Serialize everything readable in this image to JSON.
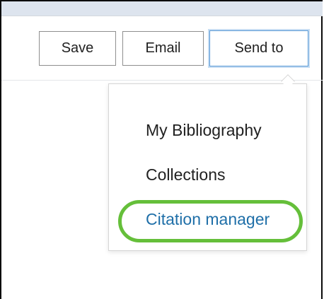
{
  "toolbar": {
    "save_label": "Save",
    "email_label": "Email",
    "send_to_label": "Send to"
  },
  "send_to_menu": {
    "items": [
      {
        "label": "My Bibliography"
      },
      {
        "label": "Collections"
      },
      {
        "label": "Citation manager",
        "highlighted": true
      }
    ]
  },
  "colors": {
    "link_blue": "#1f6fa8",
    "highlight_green": "#65bf3a",
    "focus_blue": "#5b9ad6"
  }
}
